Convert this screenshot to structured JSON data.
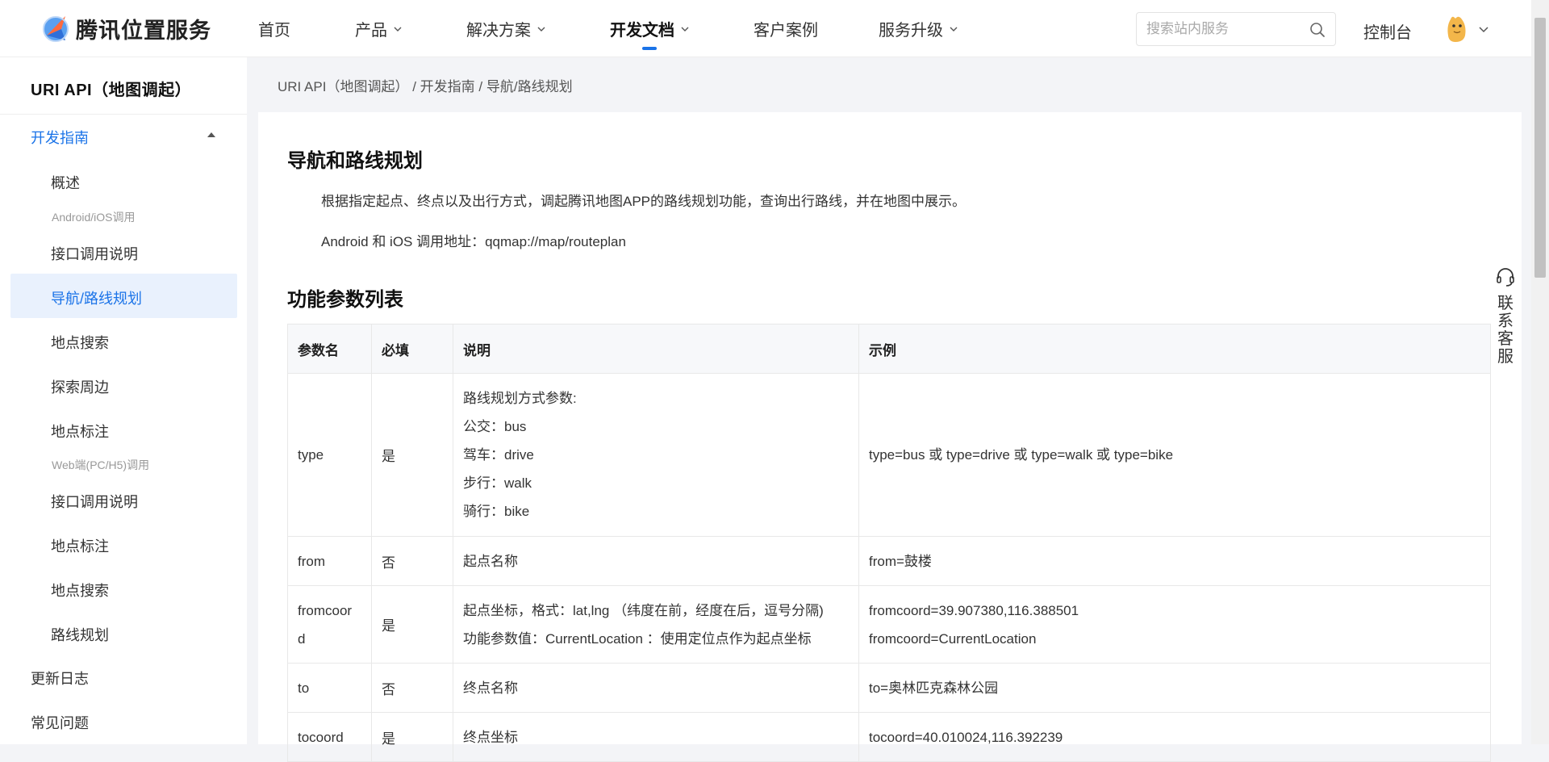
{
  "header": {
    "logo_text": "腾讯位置服务",
    "nav": [
      {
        "label": "首页",
        "has_dropdown": false,
        "active": false
      },
      {
        "label": "产品",
        "has_dropdown": true,
        "active": false
      },
      {
        "label": "解决方案",
        "has_dropdown": true,
        "active": false
      },
      {
        "label": "开发文档",
        "has_dropdown": true,
        "active": true
      },
      {
        "label": "客户案例",
        "has_dropdown": false,
        "active": false
      },
      {
        "label": "服务升级",
        "has_dropdown": true,
        "active": false
      }
    ],
    "search_placeholder": "搜索站内服务",
    "console_label": "控制台"
  },
  "sidebar": {
    "title": "URI API（地图调起）",
    "group_label": "开发指南",
    "items": [
      {
        "label": "概述"
      },
      {
        "label": "Android/iOS调用",
        "subheader": true
      },
      {
        "label": "接口调用说明"
      },
      {
        "label": "导航/路线规划",
        "active": true
      },
      {
        "label": "地点搜索"
      },
      {
        "label": "探索周边"
      },
      {
        "label": "地点标注"
      },
      {
        "label": "Web端(PC/H5)调用",
        "subheader": true
      },
      {
        "label": "接口调用说明"
      },
      {
        "label": "地点标注"
      },
      {
        "label": "地点搜索"
      },
      {
        "label": "路线规划"
      }
    ],
    "bottom_items": [
      {
        "label": "更新日志"
      },
      {
        "label": "常见问题"
      }
    ]
  },
  "breadcrumb": [
    "URI API（地图调起）",
    "开发指南",
    "导航/路线规划"
  ],
  "breadcrumb_separator": "/",
  "content": {
    "title": "导航和路线规划",
    "description": "根据指定起点、终点以及出行方式，调起腾讯地图APP的路线规划功能，查询出行路线，并在地图中展示。",
    "call_address": "Android 和 iOS 调用地址：qqmap://map/routeplan",
    "param_title": "功能参数列表",
    "table": {
      "headers": [
        "参数名",
        "必填",
        "说明",
        "示例"
      ],
      "rows": [
        {
          "name": [
            "type"
          ],
          "required": "是",
          "desc": [
            "路线规划方式参数:",
            "公交：bus",
            "驾车：drive",
            "步行：walk",
            "骑行：bike"
          ],
          "example": [
            "type=bus 或 type=drive 或 type=walk 或 type=bike"
          ]
        },
        {
          "name": [
            "from"
          ],
          "required": "否",
          "desc": [
            "起点名称"
          ],
          "example": [
            "from=鼓楼"
          ]
        },
        {
          "name": [
            "fromcoor",
            "d"
          ],
          "required": "是",
          "desc": [
            "起点坐标，格式：lat,lng （纬度在前，经度在后，逗号分隔)",
            "功能参数值：CurrentLocation ：使用定位点作为起点坐标"
          ],
          "example": [
            "fromcoord=39.907380,116.388501",
            "fromcoord=CurrentLocation"
          ]
        },
        {
          "name": [
            "to"
          ],
          "required": "否",
          "desc": [
            "终点名称"
          ],
          "example": [
            "to=奥林匹克森林公园"
          ]
        },
        {
          "name": [
            "tocoord"
          ],
          "required": "是",
          "desc": [
            "终点坐标"
          ],
          "example": [
            "tocoord=40.010024,116.392239"
          ]
        }
      ]
    }
  },
  "float_service": "联系客服",
  "colors": {
    "accent": "#1a73e8",
    "active_bg": "#e9f1fd"
  }
}
